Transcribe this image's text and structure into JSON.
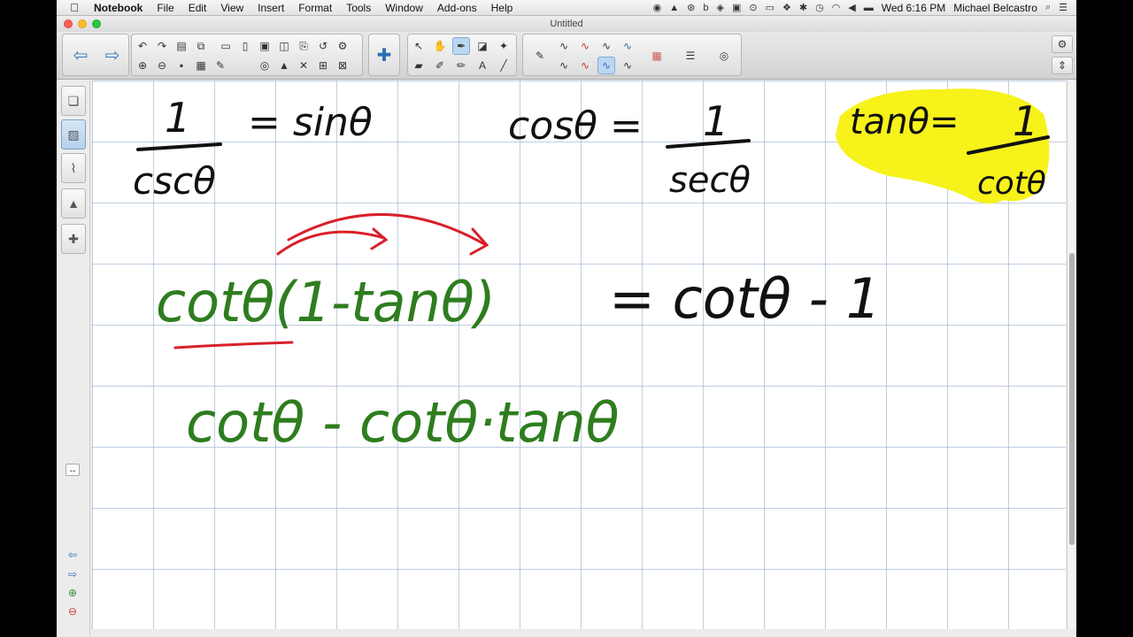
{
  "menubar": {
    "apple_icon": "apple-icon",
    "app_name": "Notebook",
    "menus": [
      "File",
      "Edit",
      "View",
      "Insert",
      "Format",
      "Tools",
      "Window",
      "Add-ons",
      "Help"
    ],
    "clock": "Wed 6:16 PM",
    "user": "Michael Belcastro"
  },
  "window": {
    "title": "Untitled"
  },
  "colors": {
    "ink_black": "#111111",
    "ink_green": "#2e7d1f",
    "ink_red": "#d8202a",
    "highlight_yellow": "#f7f21a"
  },
  "toolbar": {
    "icons": [
      "back-arrow-icon",
      "forward-arrow-icon",
      "undo-icon",
      "redo-icon",
      "open-icon",
      "save-icon",
      "paste-icon",
      "delete-icon",
      "screen-shade-icon",
      "full-screen-icon",
      "table-icon",
      "capture-icon",
      "add-ons-icon",
      "select-icon",
      "pen-icon",
      "eraser-icon",
      "line-icon",
      "shape-icon",
      "text-icon",
      "fill-icon",
      "properties-icon"
    ]
  },
  "canvas": {
    "eq1_num": "1",
    "eq1_den": "cscθ",
    "eq1_rhs": "= sinθ",
    "eq2_lhs": "cosθ =",
    "eq2_num": "1",
    "eq2_den": "secθ",
    "eq3_lhs": "tanθ=",
    "eq3_num": "1",
    "eq3_den": "cotθ",
    "line1_green": "cotθ(1-tanθ)",
    "line1_black": "= cotθ - 1",
    "line2_green": "cotθ - cotθ·tanθ"
  }
}
